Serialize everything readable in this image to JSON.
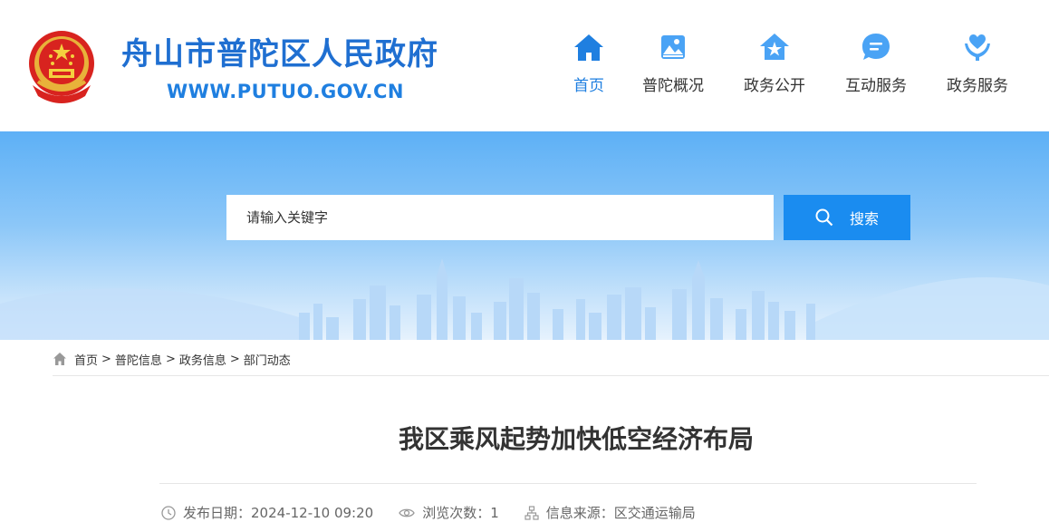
{
  "header": {
    "site_title": "舟山市普陀区人民政府",
    "site_url": "WWW.PUTUO.GOV.CN"
  },
  "nav": {
    "items": [
      {
        "label": "首页",
        "icon": "home-icon",
        "active": true
      },
      {
        "label": "普陀概况",
        "icon": "landscape-icon",
        "active": false
      },
      {
        "label": "政务公开",
        "icon": "star-house-icon",
        "active": false
      },
      {
        "label": "互动服务",
        "icon": "chat-icon",
        "active": false
      },
      {
        "label": "政务服务",
        "icon": "heart-hands-icon",
        "active": false
      }
    ]
  },
  "search": {
    "placeholder": "请输入关键字",
    "button_label": "搜索"
  },
  "breadcrumb": {
    "items": [
      "首页",
      "普陀信息",
      "政务信息",
      "部门动态"
    ],
    "separator": ">"
  },
  "article": {
    "title": "我区乘风起势加快低空经济布局",
    "date_label": "发布日期：",
    "date_value": "2024-12-10 09:20",
    "views_label": "浏览次数：",
    "views_value": "1",
    "source_label": "信息来源：",
    "source_value": "区交通运输局"
  },
  "colors": {
    "brand_blue": "#1f7fe0",
    "search_button": "#1a8cf0"
  }
}
